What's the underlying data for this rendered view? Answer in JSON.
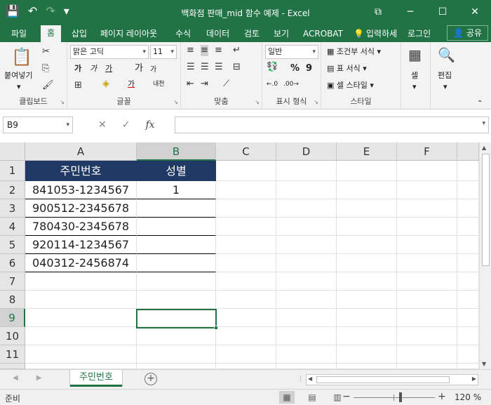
{
  "titlebar": {
    "title": "백화점 판매_mid 함수 예제 - Excel",
    "save_icon": "💾",
    "undo_icon": "↶",
    "redo_icon": "↷",
    "customize_icon": "▾",
    "ribbon_display_icon": "⧉",
    "minimize_icon": "─",
    "maximize_icon": "☐",
    "close_icon": "✕"
  },
  "tabs": [
    {
      "label": "파일"
    },
    {
      "label": "홈"
    },
    {
      "label": "삽입"
    },
    {
      "label": "페이지 레이아웃"
    },
    {
      "label": "수식"
    },
    {
      "label": "데이터"
    },
    {
      "label": "검토"
    },
    {
      "label": "보기"
    },
    {
      "label": "ACROBAT"
    },
    {
      "label": "입력하세"
    },
    {
      "label": "로그인"
    },
    {
      "label": "공유"
    }
  ],
  "ribbon": {
    "clipboard": {
      "label": "클립보드",
      "paste": "붙여넣기",
      "paste_icon": "📋",
      "cut_icon": "✂",
      "copy_icon": "⎘",
      "format_painter_icon": "🖌"
    },
    "font": {
      "label": "글꼴",
      "font_name": "맑은 고딕",
      "font_size": "11",
      "bold": "가",
      "italic": "가",
      "underline": "가",
      "grow": "가",
      "shrink": "가",
      "phonetic": "내천",
      "border_icon": "⊞",
      "fill_icon": "◈",
      "font_color": "가"
    },
    "alignment": {
      "label": "맞춤"
    },
    "number": {
      "label": "표시 형식",
      "format": "일반",
      "currency_icon": "💱",
      "percent": "%",
      "comma": "9"
    },
    "styles": {
      "label": "스타일",
      "conditional": "조건부 서식",
      "table": "표 서식",
      "cell": "셀 스타일"
    },
    "cells": {
      "label": "셀"
    },
    "editing": {
      "label": "편집"
    }
  },
  "formula_bar": {
    "name_box": "B9",
    "cancel_icon": "✕",
    "enter_icon": "✓",
    "fx": "fx",
    "formula": ""
  },
  "grid": {
    "columns": [
      "A",
      "B",
      "C",
      "D",
      "E",
      "F"
    ],
    "rows": [
      "1",
      "2",
      "3",
      "4",
      "5",
      "6",
      "7",
      "8",
      "9",
      "10",
      "11"
    ],
    "header_row": [
      "주민번호",
      "성별"
    ],
    "data": [
      [
        "841053-1234567",
        "1"
      ],
      [
        "900512-2345678",
        ""
      ],
      [
        "780430-2345678",
        ""
      ],
      [
        "920114-1234567",
        ""
      ],
      [
        "040312-2456874",
        ""
      ]
    ],
    "selected_cell": "B9"
  },
  "sheets": {
    "tabs": [
      "주민번호"
    ],
    "add_icon": "+",
    "prev_icon": "◀",
    "next_icon": "▶"
  },
  "status": {
    "ready": "준비",
    "zoom": "120 %",
    "normal_view_icon": "▦",
    "page_layout_icon": "▤",
    "page_break_icon": "▥"
  },
  "colors": {
    "brand": "#217346",
    "header_fill": "#1f3864"
  }
}
